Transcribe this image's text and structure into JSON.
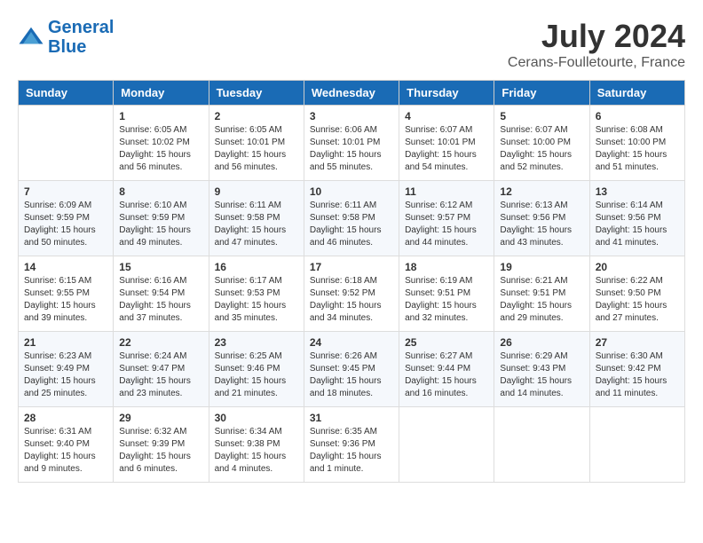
{
  "header": {
    "logo_line1": "General",
    "logo_line2": "Blue",
    "month": "July 2024",
    "location": "Cerans-Foulletourte, France"
  },
  "days_of_week": [
    "Sunday",
    "Monday",
    "Tuesday",
    "Wednesday",
    "Thursday",
    "Friday",
    "Saturday"
  ],
  "weeks": [
    [
      {
        "day": "",
        "info": ""
      },
      {
        "day": "1",
        "info": "Sunrise: 6:05 AM\nSunset: 10:02 PM\nDaylight: 15 hours\nand 56 minutes."
      },
      {
        "day": "2",
        "info": "Sunrise: 6:05 AM\nSunset: 10:01 PM\nDaylight: 15 hours\nand 56 minutes."
      },
      {
        "day": "3",
        "info": "Sunrise: 6:06 AM\nSunset: 10:01 PM\nDaylight: 15 hours\nand 55 minutes."
      },
      {
        "day": "4",
        "info": "Sunrise: 6:07 AM\nSunset: 10:01 PM\nDaylight: 15 hours\nand 54 minutes."
      },
      {
        "day": "5",
        "info": "Sunrise: 6:07 AM\nSunset: 10:00 PM\nDaylight: 15 hours\nand 52 minutes."
      },
      {
        "day": "6",
        "info": "Sunrise: 6:08 AM\nSunset: 10:00 PM\nDaylight: 15 hours\nand 51 minutes."
      }
    ],
    [
      {
        "day": "7",
        "info": "Sunrise: 6:09 AM\nSunset: 9:59 PM\nDaylight: 15 hours\nand 50 minutes."
      },
      {
        "day": "8",
        "info": "Sunrise: 6:10 AM\nSunset: 9:59 PM\nDaylight: 15 hours\nand 49 minutes."
      },
      {
        "day": "9",
        "info": "Sunrise: 6:11 AM\nSunset: 9:58 PM\nDaylight: 15 hours\nand 47 minutes."
      },
      {
        "day": "10",
        "info": "Sunrise: 6:11 AM\nSunset: 9:58 PM\nDaylight: 15 hours\nand 46 minutes."
      },
      {
        "day": "11",
        "info": "Sunrise: 6:12 AM\nSunset: 9:57 PM\nDaylight: 15 hours\nand 44 minutes."
      },
      {
        "day": "12",
        "info": "Sunrise: 6:13 AM\nSunset: 9:56 PM\nDaylight: 15 hours\nand 43 minutes."
      },
      {
        "day": "13",
        "info": "Sunrise: 6:14 AM\nSunset: 9:56 PM\nDaylight: 15 hours\nand 41 minutes."
      }
    ],
    [
      {
        "day": "14",
        "info": "Sunrise: 6:15 AM\nSunset: 9:55 PM\nDaylight: 15 hours\nand 39 minutes."
      },
      {
        "day": "15",
        "info": "Sunrise: 6:16 AM\nSunset: 9:54 PM\nDaylight: 15 hours\nand 37 minutes."
      },
      {
        "day": "16",
        "info": "Sunrise: 6:17 AM\nSunset: 9:53 PM\nDaylight: 15 hours\nand 35 minutes."
      },
      {
        "day": "17",
        "info": "Sunrise: 6:18 AM\nSunset: 9:52 PM\nDaylight: 15 hours\nand 34 minutes."
      },
      {
        "day": "18",
        "info": "Sunrise: 6:19 AM\nSunset: 9:51 PM\nDaylight: 15 hours\nand 32 minutes."
      },
      {
        "day": "19",
        "info": "Sunrise: 6:21 AM\nSunset: 9:51 PM\nDaylight: 15 hours\nand 29 minutes."
      },
      {
        "day": "20",
        "info": "Sunrise: 6:22 AM\nSunset: 9:50 PM\nDaylight: 15 hours\nand 27 minutes."
      }
    ],
    [
      {
        "day": "21",
        "info": "Sunrise: 6:23 AM\nSunset: 9:49 PM\nDaylight: 15 hours\nand 25 minutes."
      },
      {
        "day": "22",
        "info": "Sunrise: 6:24 AM\nSunset: 9:47 PM\nDaylight: 15 hours\nand 23 minutes."
      },
      {
        "day": "23",
        "info": "Sunrise: 6:25 AM\nSunset: 9:46 PM\nDaylight: 15 hours\nand 21 minutes."
      },
      {
        "day": "24",
        "info": "Sunrise: 6:26 AM\nSunset: 9:45 PM\nDaylight: 15 hours\nand 18 minutes."
      },
      {
        "day": "25",
        "info": "Sunrise: 6:27 AM\nSunset: 9:44 PM\nDaylight: 15 hours\nand 16 minutes."
      },
      {
        "day": "26",
        "info": "Sunrise: 6:29 AM\nSunset: 9:43 PM\nDaylight: 15 hours\nand 14 minutes."
      },
      {
        "day": "27",
        "info": "Sunrise: 6:30 AM\nSunset: 9:42 PM\nDaylight: 15 hours\nand 11 minutes."
      }
    ],
    [
      {
        "day": "28",
        "info": "Sunrise: 6:31 AM\nSunset: 9:40 PM\nDaylight: 15 hours\nand 9 minutes."
      },
      {
        "day": "29",
        "info": "Sunrise: 6:32 AM\nSunset: 9:39 PM\nDaylight: 15 hours\nand 6 minutes."
      },
      {
        "day": "30",
        "info": "Sunrise: 6:34 AM\nSunset: 9:38 PM\nDaylight: 15 hours\nand 4 minutes."
      },
      {
        "day": "31",
        "info": "Sunrise: 6:35 AM\nSunset: 9:36 PM\nDaylight: 15 hours\nand 1 minute."
      },
      {
        "day": "",
        "info": ""
      },
      {
        "day": "",
        "info": ""
      },
      {
        "day": "",
        "info": ""
      }
    ]
  ]
}
